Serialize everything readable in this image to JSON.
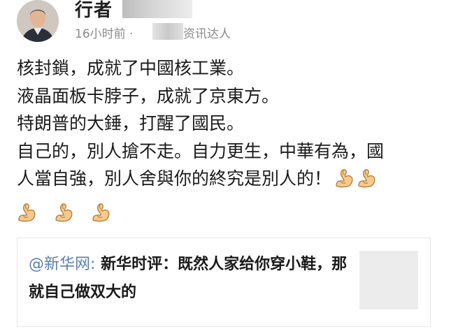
{
  "author": {
    "name": "行者",
    "time": "16小时前 · ",
    "source": "资讯达人"
  },
  "post": {
    "lines": [
      "核封鎖，成就了中國核工業。",
      "液晶面板卡脖子，成就了京東方。",
      "特朗普的大錘，打醒了國民。",
      "自己的，別人搶不走。自力更生，中華有為，國",
      "人當自強，別人舍與你的終究是別人的！"
    ],
    "emoji": "flexed-biceps"
  },
  "share_card": {
    "mention": "@新华网:",
    "text": " 新华时评：既然人家给你穿小鞋，那就自己做双大的"
  },
  "colors": {
    "link": "#5a7fb0",
    "meta": "#8a8a8a",
    "text": "#1a1a1a"
  }
}
